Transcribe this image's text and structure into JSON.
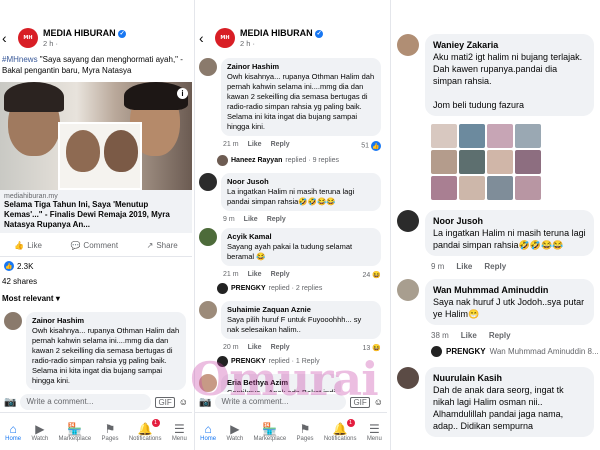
{
  "panel1": {
    "page_name": "MEDIA HIBURAN",
    "post_time": "2 h ·",
    "caption_tag": "#MHnews",
    "caption": " \"Saya sayang dan menghormati ayah,\" - Bakal pengantin baru, Myra Natasya",
    "caption_start": "jaru, Myra Natasya",
    "link_domain": "mediahiburan.my",
    "link_title": "Selama Tiga Tahun Ini, Saya 'Menutup Kemas'...\" - Finalis Dewi Remaja 2019, Myra Natasya Rupanya An...",
    "like_label": "Like",
    "comment_label": "Comment",
    "share_label": "Share",
    "reaction_count": "2.3K",
    "shares": "42 shares",
    "sort_label": "Most relevant",
    "comment": {
      "name": "Zainor Hashim",
      "text": "Owh kisahnya... rupanya Othman Halim dah pernah kahwin selama ini....mmg dia dan kawan 2 sekeilling dia semasa bertugas di radio-radio simpan rahsia yg paling baik. Selama ini kita ingat dia bujang sampai hingga kini."
    }
  },
  "panel2": {
    "page_name": "MEDIA HIBURAN",
    "post_time": "2 h ·",
    "comments": [
      {
        "name": "Zainor Hashim",
        "text": "Owh kisahnya... rupanya Othman Halim dah pernah kahwin selama ini....mmg dia dan kawan 2 sekeilling dia semasa bertugas di radio-radio simpan rahsia yg paling baik. Selama ini kita ingat dia bujang sampai hingga kini.",
        "time": "21 m",
        "like": "Like",
        "reply": "Reply",
        "react_count": "51",
        "replied_name": "Haneez Rayyan",
        "replied_text": "replied · 9 replies"
      },
      {
        "name": "Noor Jusoh",
        "text": "La ingatkan Halim ni masih teruna lagi pandai simpan rahsia🤣🤣😂😂",
        "time": "9 m",
        "like": "Like",
        "reply": "Reply"
      },
      {
        "name": "Acyik Kamal",
        "text": "Sayang ayah pakai la tudung selamat beramal 😂",
        "time": "21 m",
        "like": "Like",
        "reply": "Reply",
        "react_count": "24",
        "replied_name": "PRENGKY",
        "replied_text": "replied · 2 replies"
      },
      {
        "name": "Suhaimie Zaquan Aznie",
        "text": "Saya pilih huruf F untuk Fuyooohhh... sy nak selesaikan halim..",
        "time": "20 m",
        "like": "Like",
        "reply": "Reply",
        "react_count": "13",
        "replied_name": "PRENGKY",
        "replied_text": "replied · 1 Reply"
      },
      {
        "name": "Eria Bethya Azim",
        "text": "Cantiknye... Anak ada Bakat indi"
      }
    ]
  },
  "panel3": {
    "comments": [
      {
        "name": "Waniey Zakaria",
        "text": "Aku mati2 igt halim ni bujang terlajak. Dah kawen rupanya.pandai dia simpan rahsia.\n\nJom beli tudung fazura"
      },
      {
        "name": "Noor Jusoh",
        "text": "La ingatkan Halim ni masih teruna lagi pandai simpan rahsia🤣🤣😂😂",
        "time": "9 m",
        "like": "Like",
        "reply": "Reply"
      },
      {
        "name": "Wan Muhmmad Aminuddin",
        "text": "Saya nak huruf J utk Jodoh..sya putar ye Halim😁",
        "time": "38 m",
        "like": "Like",
        "reply": "Reply",
        "replied_name": "PRENGKY",
        "replied_text": "Wan Muhmmad Aminuddin 8..."
      },
      {
        "name": "Nuurulain Kasih",
        "text": "Dah de anak dara seorg, ingat tk nikah lagi Halim osman nii.. Alhamdulillah pandai jaga nama, adap.. Didikan sempurna"
      }
    ]
  },
  "composer_placeholder": "Write a comment...",
  "composer_gif": "GIF",
  "tabs": [
    {
      "label": "Home",
      "icon": "home-icon"
    },
    {
      "label": "Watch",
      "icon": "watch-icon"
    },
    {
      "label": "Marketplace",
      "icon": "marketplace-icon"
    },
    {
      "label": "Pages",
      "icon": "pages-flag-icon"
    },
    {
      "label": "Notifications",
      "icon": "bell-icon",
      "badge": "1"
    },
    {
      "label": "Menu",
      "icon": "menu-icon"
    }
  ],
  "watermark": "Omurai",
  "colors": {
    "accent": "#1877f2",
    "brand": "#d81e25",
    "badge": "#e41e3f"
  }
}
